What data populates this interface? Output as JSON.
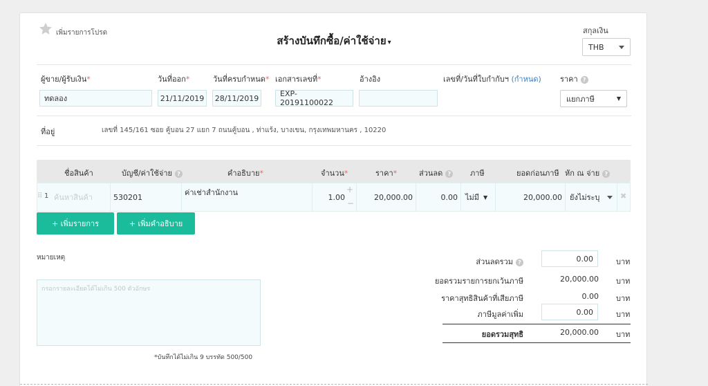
{
  "header": {
    "favorite_label": "เพิ่มรายการโปรด",
    "title": "สร้างบันทึกซื้อ/ค่าใช้จ่าย",
    "title_caret": "▾",
    "currency_label": "สกุลเงิน",
    "currency_value": "THB"
  },
  "fields": {
    "vendor_label": "ผู้ขาย/ผู้รับเงิน",
    "vendor_value": "ทดลอง",
    "issue_date_label": "วันที่ออก",
    "issue_date_value": "21/11/2019",
    "due_date_label": "วันที่ครบกำหนด",
    "due_date_value": "28/11/2019",
    "doc_no_label": "เอกสารเลขที่",
    "doc_no_value": "EXP-20191100022",
    "reference_label": "อ้างอิง",
    "reference_value": "",
    "tax_invoice_label": "เลขที่/วันที่ใบกำกับฯ",
    "tax_invoice_link": "(กำหนด)",
    "price_label": "ราคา",
    "price_value": "แยกภาษี",
    "address_label": "ที่อยู่",
    "address_value": "เลขที่ 145/161 ซอย คู้บอน 27 แยก 7 ถนนคู้บอน , ท่าแร้ง, บางเขน, กรุงเทพมหานคร , 10220"
  },
  "table": {
    "headers": {
      "product": "ชื่อสินค้า",
      "account": "บัญชี/ค่าใช้จ่าย",
      "description": "คำอธิบาย",
      "quantity": "จำนวน",
      "price": "ราคา",
      "discount": "ส่วนลด",
      "tax": "ภาษี",
      "pretax_total": "ยอดก่อนภาษี",
      "withholding": "หัก ณ จ่าย"
    },
    "rows": [
      {
        "index": "1",
        "product_placeholder": "ค้นหาสินค้า",
        "account": "530201",
        "description": "ค่าเช่าสำนักงาน",
        "quantity": "1.00",
        "price": "20,000.00",
        "discount": "0.00",
        "tax": "ไม่มี",
        "pretax_total": "20,000.00",
        "withholding": "ยังไม่ระบุ"
      }
    ]
  },
  "buttons": {
    "add_item": "+ เพิ่มรายการ",
    "add_description": "+ เพิ่มคำอธิบาย"
  },
  "notes": {
    "label": "หมายเหตุ",
    "placeholder": "กรอกรายละเอียดได้ไม่เกิน 500 ตัวอักษร",
    "counter": "*บันทึกได้ไม่เกิน 9 บรรทัด 500/500"
  },
  "summary": {
    "total_discount_label": "ส่วนลดรวม",
    "total_discount_value": "0.00",
    "exempt_total_label": "ยอดรวมรายการยกเว้นภาษี",
    "exempt_total_value": "20,000.00",
    "taxable_label": "ราคาสุทธิสินค้าที่เสียภาษี",
    "taxable_value": "0.00",
    "vat_label": "ภาษีมูลค่าเพิ่ม",
    "vat_value": "0.00",
    "net_total_label": "ยอดรวมสุทธิ",
    "net_total_value": "20,000.00",
    "currency_unit": "บาท"
  },
  "colors": {
    "accent": "#1abc9c",
    "link": "#3a7fc1",
    "required": "#e06a6a"
  }
}
